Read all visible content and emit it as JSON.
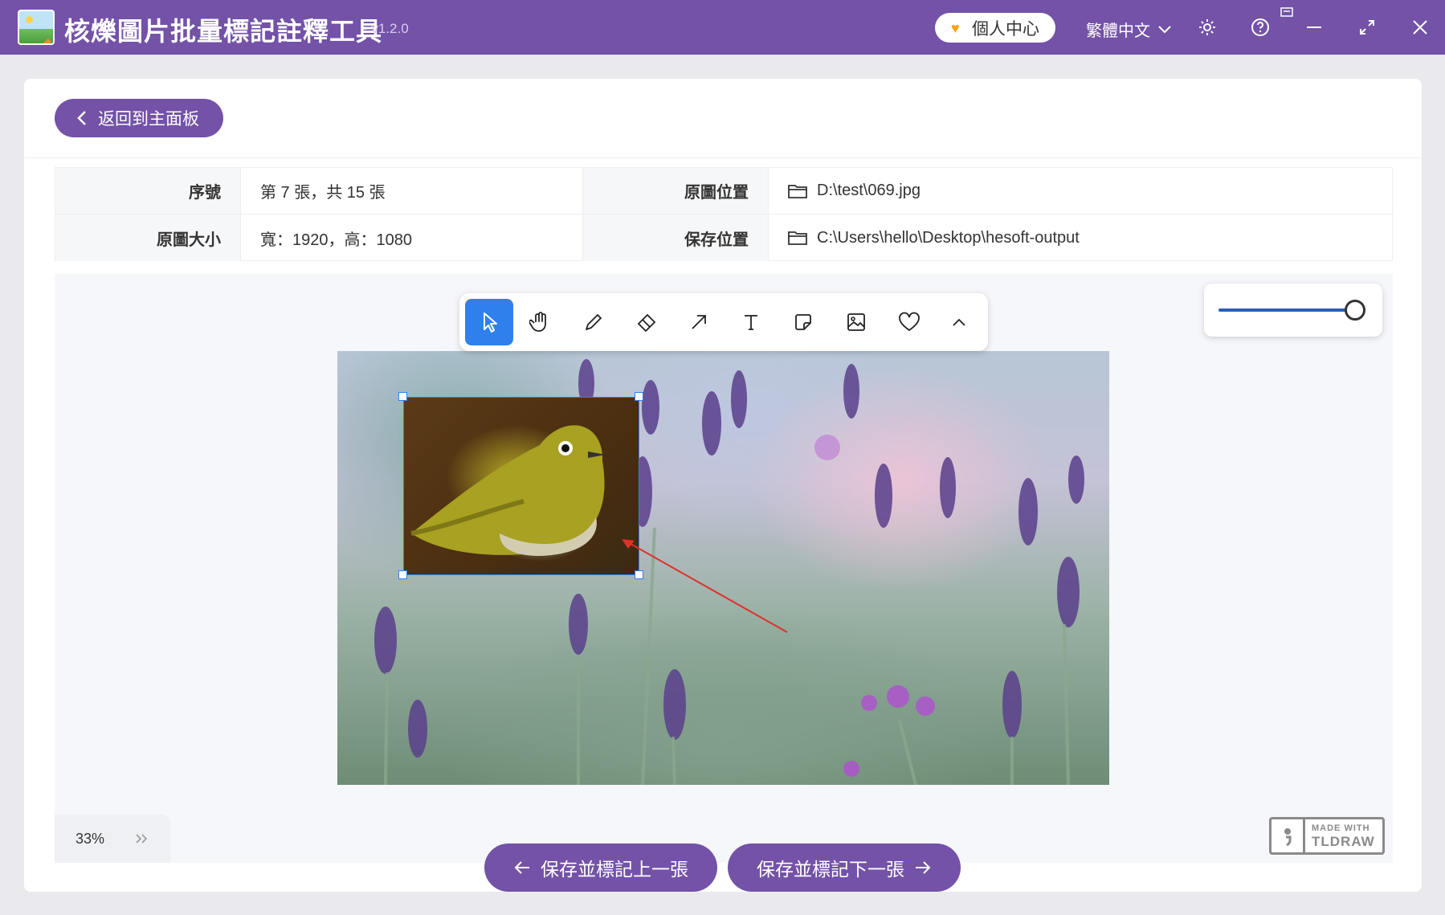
{
  "window": {
    "title": "核爍圖片批量標記註釋工具",
    "version": "- v1.2.0",
    "user_center": "個人中心",
    "language": "繁體中文",
    "icons": [
      "settings-icon",
      "help-icon",
      "minimize-icon",
      "maximize-icon",
      "close-icon"
    ]
  },
  "back_button": "返回到主面板",
  "info": {
    "index_label": "序號",
    "index_value": "第 7 張，共 15 張",
    "source_label": "原圖位置",
    "source_value": "D:\\test\\069.jpg",
    "size_label": "原圖大小",
    "size_value": "寬：1920，高：1080",
    "save_label": "保存位置",
    "save_value": "C:\\Users\\hello\\Desktop\\hesoft-output"
  },
  "toolbar": {
    "tools": [
      "select",
      "hand",
      "draw",
      "eraser",
      "arrow",
      "text",
      "note",
      "asset",
      "heart",
      "more"
    ],
    "active": "select"
  },
  "zoom": {
    "slider_level": 1.0,
    "percent": "33%"
  },
  "badge": {
    "line1": "MADE WITH",
    "line2": "TLDRAW"
  },
  "nav": {
    "prev": "保存並標記上一張",
    "next": "保存並標記下一張"
  },
  "colors": {
    "brand": "#7352a8",
    "accent": "#2f80ed",
    "arrow": "#e0302a"
  }
}
